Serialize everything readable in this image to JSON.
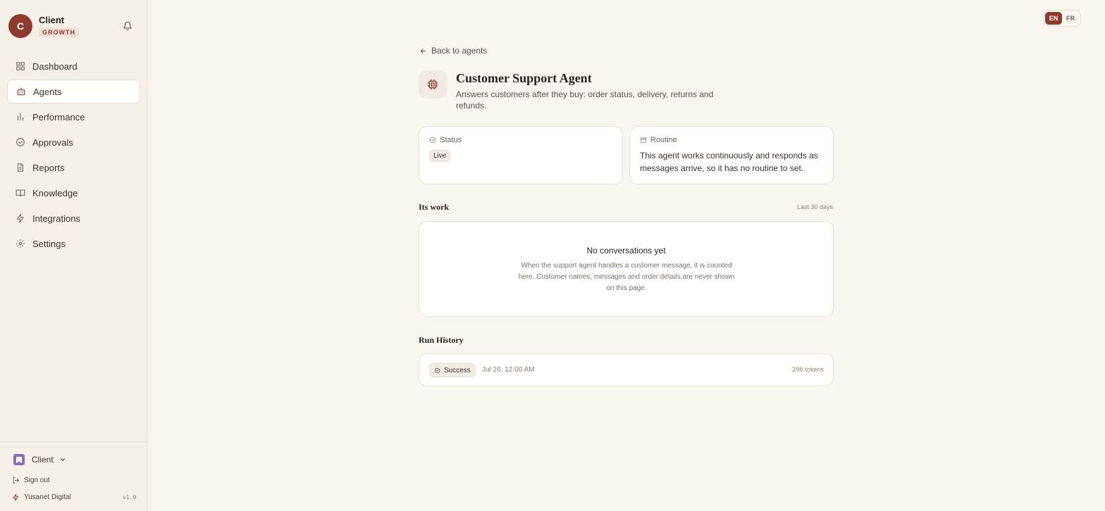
{
  "account": {
    "initial": "C",
    "name": "Client",
    "plan": "GROWTH"
  },
  "nav": [
    {
      "label": "Dashboard",
      "icon": "dashboard-icon"
    },
    {
      "label": "Agents",
      "icon": "bot-icon",
      "active": true
    },
    {
      "label": "Performance",
      "icon": "bar-chart-icon"
    },
    {
      "label": "Approvals",
      "icon": "check-circle-icon"
    },
    {
      "label": "Reports",
      "icon": "file-icon"
    },
    {
      "label": "Knowledge",
      "icon": "book-icon"
    },
    {
      "label": "Integrations",
      "icon": "bolt-icon"
    },
    {
      "label": "Settings",
      "icon": "gear-icon"
    }
  ],
  "footer": {
    "workspace": "Client",
    "sign_out": "Sign out",
    "brand": "Yusanet Digital",
    "version": "v1.0"
  },
  "lang": {
    "en": "EN",
    "fr": "FR",
    "active": "EN"
  },
  "back_label": "Back to agents",
  "agent": {
    "title": "Customer Support Agent",
    "description": "Answers customers after they buy: order status, delivery, returns and refunds."
  },
  "status_card": {
    "label": "Status",
    "value": "Live"
  },
  "routine_card": {
    "label": "Routine",
    "text": "This agent works continuously and responds as messages arrive, so it has no routine to set."
  },
  "work": {
    "title": "Its work",
    "range": "Last 30 days",
    "empty_title": "No conversations yet",
    "empty_text": "When the support agent handles a customer message, it is counted here. Customer names, messages and order details are never shown on this page."
  },
  "history": {
    "title": "Run History",
    "runs": [
      {
        "status": "Success",
        "date": "Jul 26, 12:00 AM",
        "tokens": "296",
        "tokens_unit": "tokens"
      }
    ]
  },
  "colors": {
    "accent": "#8e3a2e",
    "background": "#f9f6f0",
    "sidebar": "#f5f0e8"
  }
}
